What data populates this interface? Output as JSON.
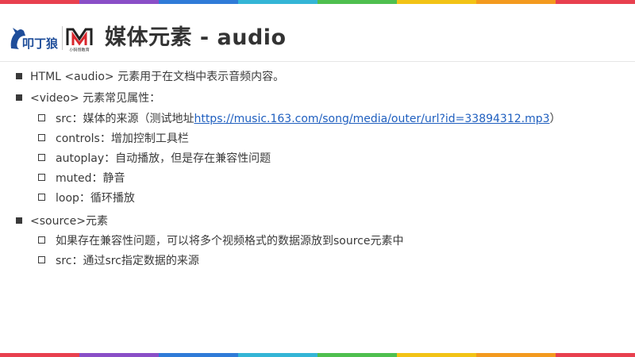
{
  "colors": {
    "rainbow": [
      "#e8404f",
      "#8a4fc7",
      "#2f7bd8",
      "#34b5d6",
      "#4fbf4f",
      "#f2c316",
      "#f39a1f",
      "#e8404f"
    ],
    "link": "#1f5fbf",
    "text": "#3a3a3a"
  },
  "header": {
    "title": "媒体元素 - audio",
    "logo1_text": "叩丁狼",
    "logo2_caption": "小码哥教育"
  },
  "content": {
    "items": [
      {
        "text": "HTML <audio> 元素用于在文档中表示音频内容。"
      },
      {
        "text": "<video> 元素常见属性：",
        "children": [
          {
            "before": "src：媒体的来源（测试地址",
            "link": "https://music.163.com/song/media/outer/url?id=33894312.mp3",
            "after": "）"
          },
          {
            "text": "controls：增加控制工具栏"
          },
          {
            "text": "autoplay：自动播放，但是存在兼容性问题"
          },
          {
            "text": "muted：静音"
          },
          {
            "text": "loop：循环播放"
          }
        ]
      },
      {
        "text": "<source>元素",
        "children": [
          {
            "text": "如果存在兼容性问题，可以将多个视频格式的数据源放到source元素中"
          },
          {
            "text": "src：通过src指定数据的来源"
          }
        ]
      }
    ]
  }
}
